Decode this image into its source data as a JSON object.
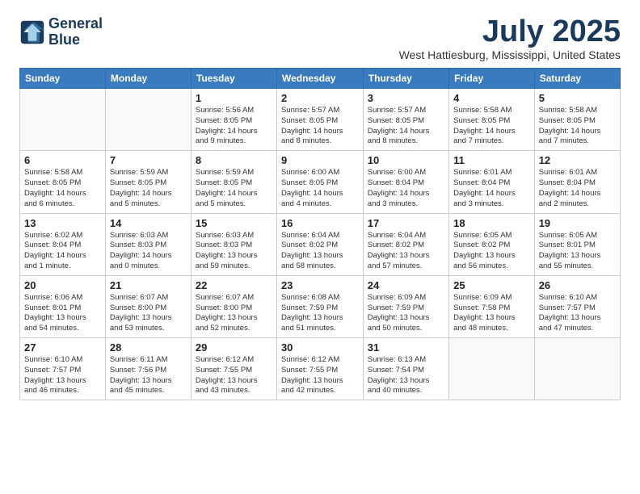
{
  "header": {
    "logo_line1": "General",
    "logo_line2": "Blue",
    "month_title": "July 2025",
    "subtitle": "West Hattiesburg, Mississippi, United States"
  },
  "calendar": {
    "days_of_week": [
      "Sunday",
      "Monday",
      "Tuesday",
      "Wednesday",
      "Thursday",
      "Friday",
      "Saturday"
    ],
    "weeks": [
      [
        {
          "day": "",
          "info": ""
        },
        {
          "day": "",
          "info": ""
        },
        {
          "day": "1",
          "info": "Sunrise: 5:56 AM\nSunset: 8:05 PM\nDaylight: 14 hours\nand 9 minutes."
        },
        {
          "day": "2",
          "info": "Sunrise: 5:57 AM\nSunset: 8:05 PM\nDaylight: 14 hours\nand 8 minutes."
        },
        {
          "day": "3",
          "info": "Sunrise: 5:57 AM\nSunset: 8:05 PM\nDaylight: 14 hours\nand 8 minutes."
        },
        {
          "day": "4",
          "info": "Sunrise: 5:58 AM\nSunset: 8:05 PM\nDaylight: 14 hours\nand 7 minutes."
        },
        {
          "day": "5",
          "info": "Sunrise: 5:58 AM\nSunset: 8:05 PM\nDaylight: 14 hours\nand 7 minutes."
        }
      ],
      [
        {
          "day": "6",
          "info": "Sunrise: 5:58 AM\nSunset: 8:05 PM\nDaylight: 14 hours\nand 6 minutes."
        },
        {
          "day": "7",
          "info": "Sunrise: 5:59 AM\nSunset: 8:05 PM\nDaylight: 14 hours\nand 5 minutes."
        },
        {
          "day": "8",
          "info": "Sunrise: 5:59 AM\nSunset: 8:05 PM\nDaylight: 14 hours\nand 5 minutes."
        },
        {
          "day": "9",
          "info": "Sunrise: 6:00 AM\nSunset: 8:05 PM\nDaylight: 14 hours\nand 4 minutes."
        },
        {
          "day": "10",
          "info": "Sunrise: 6:00 AM\nSunset: 8:04 PM\nDaylight: 14 hours\nand 3 minutes."
        },
        {
          "day": "11",
          "info": "Sunrise: 6:01 AM\nSunset: 8:04 PM\nDaylight: 14 hours\nand 3 minutes."
        },
        {
          "day": "12",
          "info": "Sunrise: 6:01 AM\nSunset: 8:04 PM\nDaylight: 14 hours\nand 2 minutes."
        }
      ],
      [
        {
          "day": "13",
          "info": "Sunrise: 6:02 AM\nSunset: 8:04 PM\nDaylight: 14 hours\nand 1 minute."
        },
        {
          "day": "14",
          "info": "Sunrise: 6:03 AM\nSunset: 8:03 PM\nDaylight: 14 hours\nand 0 minutes."
        },
        {
          "day": "15",
          "info": "Sunrise: 6:03 AM\nSunset: 8:03 PM\nDaylight: 13 hours\nand 59 minutes."
        },
        {
          "day": "16",
          "info": "Sunrise: 6:04 AM\nSunset: 8:02 PM\nDaylight: 13 hours\nand 58 minutes."
        },
        {
          "day": "17",
          "info": "Sunrise: 6:04 AM\nSunset: 8:02 PM\nDaylight: 13 hours\nand 57 minutes."
        },
        {
          "day": "18",
          "info": "Sunrise: 6:05 AM\nSunset: 8:02 PM\nDaylight: 13 hours\nand 56 minutes."
        },
        {
          "day": "19",
          "info": "Sunrise: 6:05 AM\nSunset: 8:01 PM\nDaylight: 13 hours\nand 55 minutes."
        }
      ],
      [
        {
          "day": "20",
          "info": "Sunrise: 6:06 AM\nSunset: 8:01 PM\nDaylight: 13 hours\nand 54 minutes."
        },
        {
          "day": "21",
          "info": "Sunrise: 6:07 AM\nSunset: 8:00 PM\nDaylight: 13 hours\nand 53 minutes."
        },
        {
          "day": "22",
          "info": "Sunrise: 6:07 AM\nSunset: 8:00 PM\nDaylight: 13 hours\nand 52 minutes."
        },
        {
          "day": "23",
          "info": "Sunrise: 6:08 AM\nSunset: 7:59 PM\nDaylight: 13 hours\nand 51 minutes."
        },
        {
          "day": "24",
          "info": "Sunrise: 6:09 AM\nSunset: 7:59 PM\nDaylight: 13 hours\nand 50 minutes."
        },
        {
          "day": "25",
          "info": "Sunrise: 6:09 AM\nSunset: 7:58 PM\nDaylight: 13 hours\nand 48 minutes."
        },
        {
          "day": "26",
          "info": "Sunrise: 6:10 AM\nSunset: 7:57 PM\nDaylight: 13 hours\nand 47 minutes."
        }
      ],
      [
        {
          "day": "27",
          "info": "Sunrise: 6:10 AM\nSunset: 7:57 PM\nDaylight: 13 hours\nand 46 minutes."
        },
        {
          "day": "28",
          "info": "Sunrise: 6:11 AM\nSunset: 7:56 PM\nDaylight: 13 hours\nand 45 minutes."
        },
        {
          "day": "29",
          "info": "Sunrise: 6:12 AM\nSunset: 7:55 PM\nDaylight: 13 hours\nand 43 minutes."
        },
        {
          "day": "30",
          "info": "Sunrise: 6:12 AM\nSunset: 7:55 PM\nDaylight: 13 hours\nand 42 minutes."
        },
        {
          "day": "31",
          "info": "Sunrise: 6:13 AM\nSunset: 7:54 PM\nDaylight: 13 hours\nand 40 minutes."
        },
        {
          "day": "",
          "info": ""
        },
        {
          "day": "",
          "info": ""
        }
      ]
    ]
  }
}
